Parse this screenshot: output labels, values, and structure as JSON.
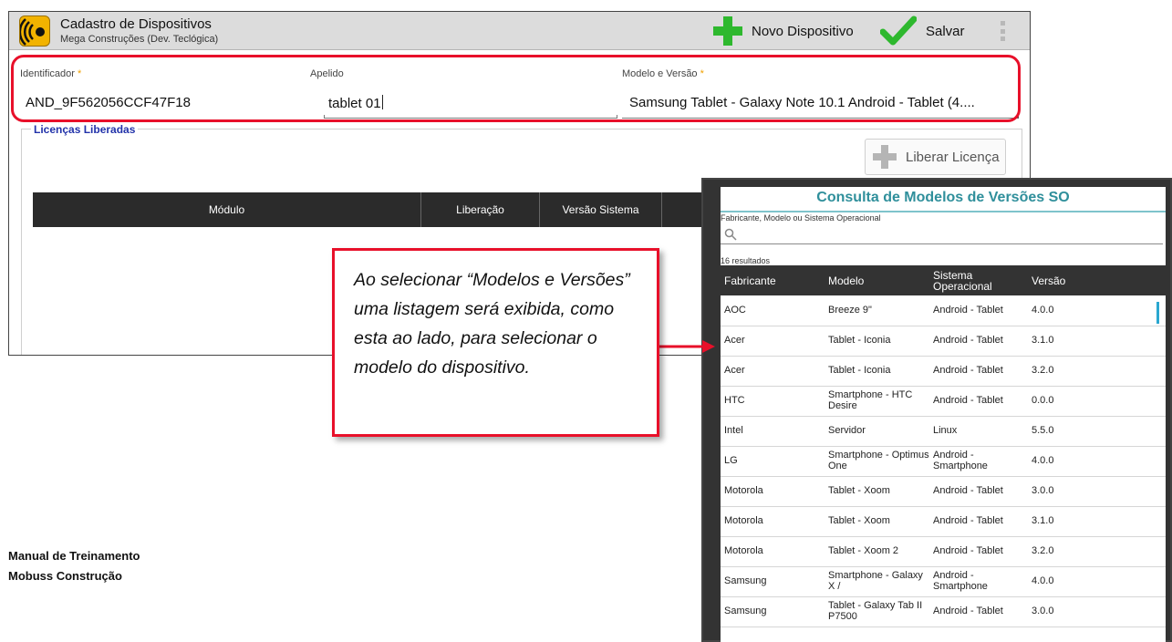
{
  "app": {
    "title": "Cadastro de Dispositivos",
    "subtitle": "Mega Construções (Dev. Teclógica)",
    "logo_icon": "signal-waves-icon",
    "new_device_label": "Novo Dispositivo",
    "save_label": "Salvar"
  },
  "fields": {
    "identificador_label": "Identificador",
    "identificador_value": "AND_9F562056CCF47F18",
    "apelido_label": "Apelido",
    "apelido_value": "tablet 01",
    "modelo_label": "Modelo e Versão",
    "modelo_value": "Samsung Tablet - Galaxy Note 10.1 Android - Tablet (4....",
    "required_mark": "*"
  },
  "licencas": {
    "title": "Licenças Liberadas",
    "button_label": "Liberar Licença",
    "columns": [
      "Módulo",
      "Liberação",
      "Versão Sistema",
      ""
    ]
  },
  "popup": {
    "title": "Consulta de Modelos de Versões SO",
    "search_label": "Fabricante, Modelo ou Sistema Operacional",
    "search_value": "",
    "results_count": "16 resultados",
    "columns": [
      "Fabricante",
      "Modelo",
      "Sistema Operacional",
      "Versão"
    ],
    "rows": [
      [
        "AOC",
        "Breeze 9\"",
        "Android - Tablet",
        "4.0.0"
      ],
      [
        "Acer",
        "Tablet - Iconia",
        "Android - Tablet",
        "3.1.0"
      ],
      [
        "Acer",
        "Tablet - Iconia",
        "Android - Tablet",
        "3.2.0"
      ],
      [
        "HTC",
        "Smartphone - HTC Desire",
        "Android - Tablet",
        "0.0.0"
      ],
      [
        "Intel",
        "Servidor",
        "Linux",
        "5.5.0"
      ],
      [
        "LG",
        "Smartphone - Optimus One",
        "Android - Smartphone",
        "4.0.0"
      ],
      [
        "Motorola",
        "Tablet - Xoom",
        "Android - Tablet",
        "3.0.0"
      ],
      [
        "Motorola",
        "Tablet - Xoom",
        "Android - Tablet",
        "3.1.0"
      ],
      [
        "Motorola",
        "Tablet - Xoom 2",
        "Android - Tablet",
        "3.2.0"
      ],
      [
        "Samsung",
        "Smartphone - Galaxy X /",
        "Android - Smartphone",
        "4.0.0"
      ],
      [
        "Samsung",
        "Tablet - Galaxy Tab II P7500",
        "Android - Tablet",
        "3.0.0"
      ]
    ]
  },
  "callout": {
    "text": "Ao selecionar “Modelos e Versões” uma listagem será exibida, como esta ao lado, para selecionar o modelo do dispositivo."
  },
  "footer": {
    "line1": "Manual de Treinamento",
    "line2": "Mobuss Construção"
  },
  "colors": {
    "highlight_red": "#e8102a",
    "add_green": "#2eb82e",
    "popup_title": "#2f8f9b",
    "required": "#f0a000"
  }
}
